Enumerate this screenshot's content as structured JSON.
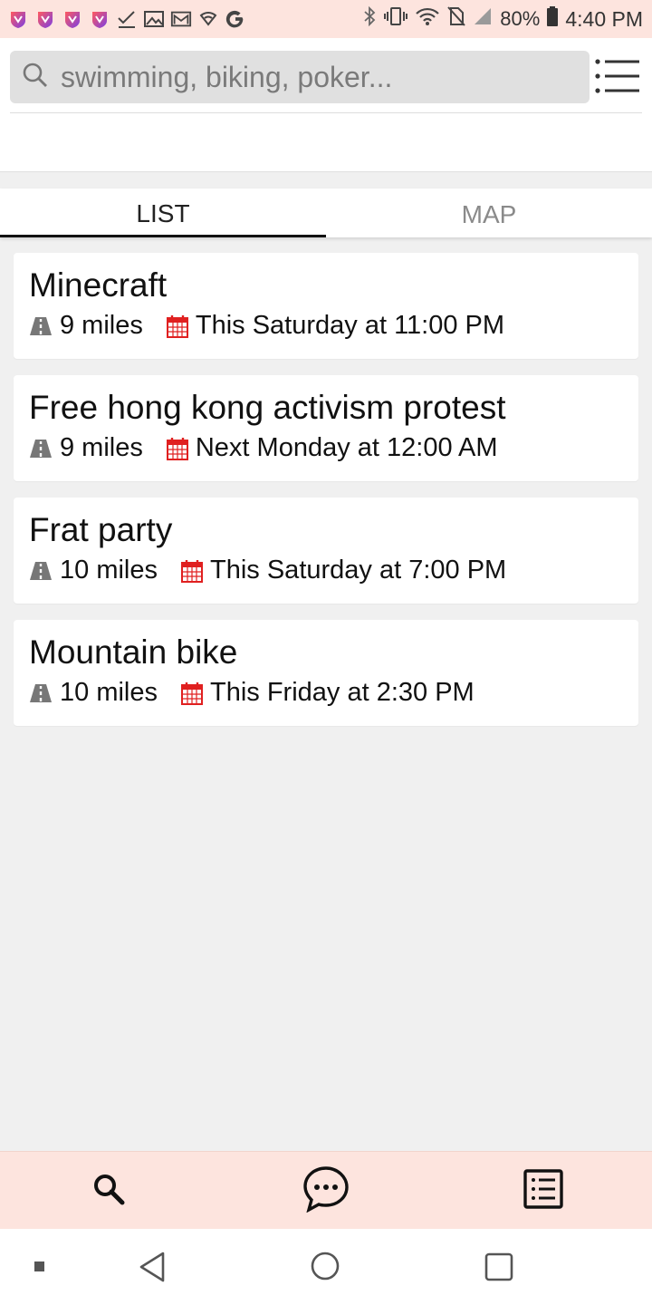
{
  "status_bar": {
    "notification_icons": [
      "brand-app-icon",
      "brand-app-icon",
      "brand-app-icon",
      "brand-app-icon",
      "checkmark-icon",
      "image-icon",
      "mail-icon",
      "vpn-shield-icon",
      "google-icon"
    ],
    "system_icons": [
      "bluetooth-icon",
      "vibrate-icon",
      "wifi-icon",
      "no-sim-icon",
      "signal-icon"
    ],
    "battery_percent": "80%",
    "time": "4:40 PM"
  },
  "search": {
    "placeholder": "swimming, biking, poker..."
  },
  "tabs": [
    {
      "label": "LIST",
      "active": true
    },
    {
      "label": "MAP",
      "active": false
    }
  ],
  "events": [
    {
      "title": "Minecraft",
      "distance": "9 miles",
      "date": "This Saturday at 11:00 PM"
    },
    {
      "title": "Free hong kong activism protest",
      "distance": "9 miles",
      "date": "Next Monday at 12:00 AM"
    },
    {
      "title": "Frat party",
      "distance": "10 miles",
      "date": "This Saturday at 7:00 PM"
    },
    {
      "title": "Mountain bike",
      "distance": "10 miles",
      "date": "This Friday at 2:30 PM"
    }
  ],
  "bottom_nav": [
    "search-icon",
    "chat-icon",
    "list-icon"
  ],
  "colors": {
    "accent_bar": "#fde4de",
    "calendar_red": "#e02020",
    "road_gray": "#777777"
  }
}
